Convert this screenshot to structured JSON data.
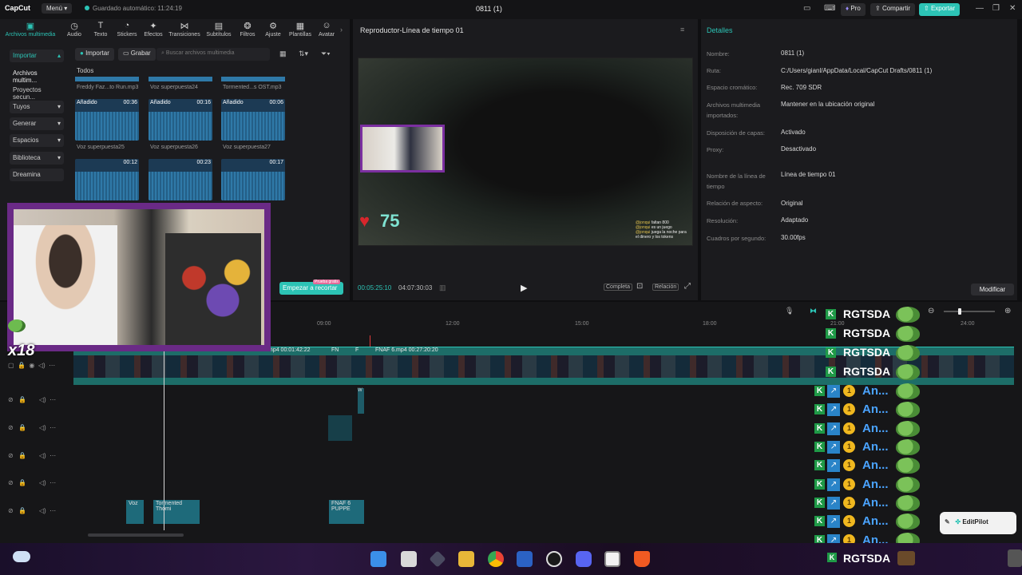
{
  "titlebar": {
    "logo": "CapCut",
    "menu": "Menú",
    "autosave": "Guardado automático: 11:24:19",
    "project_title": "0811 (1)",
    "pro": "Pro",
    "share": "Compartir",
    "export": "Exportar"
  },
  "media_toolbar": [
    {
      "label": "Archivos multimedia",
      "icon": "media-icon"
    },
    {
      "label": "Audio",
      "icon": "audio-icon"
    },
    {
      "label": "Texto",
      "icon": "text-icon"
    },
    {
      "label": "Stickers",
      "icon": "sticker-icon"
    },
    {
      "label": "Efectos",
      "icon": "effects-icon"
    },
    {
      "label": "Transiciones",
      "icon": "transitions-icon"
    },
    {
      "label": "Subtítulos",
      "icon": "subtitles-icon"
    },
    {
      "label": "Filtros",
      "icon": "filters-icon"
    },
    {
      "label": "Ajuste",
      "icon": "adjust-icon"
    },
    {
      "label": "Plantillas",
      "icon": "templates-icon"
    },
    {
      "label": "Avatar",
      "icon": "avatar-icon"
    }
  ],
  "sidebar": [
    {
      "label": "Importar"
    },
    {
      "label": "Archivos multim..."
    },
    {
      "label": "Proyectos secun..."
    },
    {
      "label": "Tuyos"
    },
    {
      "label": "Generar"
    },
    {
      "label": "Espacios"
    },
    {
      "label": "Biblioteca"
    },
    {
      "label": "Dreamina"
    }
  ],
  "media_actions": {
    "import": "Importar",
    "record": "Grabar",
    "search_placeholder": "Buscar archivos multimedia",
    "filter_all": "Todos"
  },
  "media_top_labels": [
    "Freddy Faz...to Run.mp3",
    "Voz superpuesta24",
    "Tormented...s OST.mp3"
  ],
  "media_tiles": [
    {
      "badge": "Añadido",
      "duration": "00:36",
      "label": "Voz superpuesta25"
    },
    {
      "badge": "Añadido",
      "duration": "00:16",
      "label": "Voz superpuesta26"
    },
    {
      "badge": "Añadido",
      "duration": "00:06",
      "label": "Voz superpuesta27"
    },
    {
      "badge": "",
      "duration": "00:12",
      "label": ""
    },
    {
      "badge": "",
      "duration": "00:23",
      "label": ""
    },
    {
      "badge": "",
      "duration": "00:17",
      "label": ""
    }
  ],
  "cta": {
    "label": "Empezar a recortar",
    "badge": "Prueba gratis"
  },
  "overlay": {
    "multiplier": "x18"
  },
  "player": {
    "title": "Reproductor-Línea de tiempo 01",
    "health": "75",
    "current_time": "00:05:25:10",
    "total_time": "04:07:30:03",
    "btn_full": "Completa",
    "btn_ratio": "Relación",
    "chat": [
      {
        "user": "@jonqui",
        "text": "faltan 800"
      },
      {
        "user": "@jonqui",
        "text": "es un juego"
      },
      {
        "user": "@jonqui",
        "text": "juega la noche para el dinero y los tokens"
      }
    ]
  },
  "details": {
    "title": "Detalles",
    "rows": [
      {
        "label": "Nombre:",
        "value": "0811 (1)"
      },
      {
        "label": "Ruta:",
        "value": "C:/Users/gianl/AppData/Local/CapCut Drafts/0811 (1)"
      },
      {
        "label": "Espacio cromático:",
        "value": "Rec. 709 SDR"
      },
      {
        "label": "Archivos multimedia importados:",
        "value": "Mantener en la ubicación original"
      },
      {
        "label": "Disposición de capas:",
        "value": "Activado"
      },
      {
        "label": "Proxy:",
        "value": "Desactivado"
      },
      {
        "label": "Nombre de la línea de tiempo",
        "value": "Línea de tiempo 01"
      },
      {
        "label": "Relación de aspecto:",
        "value": "Original"
      },
      {
        "label": "Resolución:",
        "value": "Adaptado"
      },
      {
        "label": "Cuadros por segundo:",
        "value": "30.00fps"
      }
    ],
    "modify": "Modificar"
  },
  "timeline": {
    "ruler": [
      "09:00",
      "12:00",
      "15:00",
      "18:00",
      "21:00",
      "24:00"
    ],
    "clips": {
      "main_a": "mp4  00:01:42:22",
      "main_b": "FN",
      "main_c": "F",
      "main_d": "FNAF 6.mp4  00:27:20:20",
      "audio_a": "Voz",
      "audio_b": "Tormented Thomi",
      "audio_c": "FNAF 6 PUPPE",
      "small": "W"
    }
  },
  "stream_chat": {
    "name": "RGTSDA",
    "short": "An...",
    "coin": "1",
    "k": "K"
  },
  "editpilot": "EditPilot",
  "colors": {
    "accent": "#2cc3b5",
    "export": "#2cc3b5",
    "webcam_frame": "#6a2a86",
    "heart": "#d8262c"
  }
}
